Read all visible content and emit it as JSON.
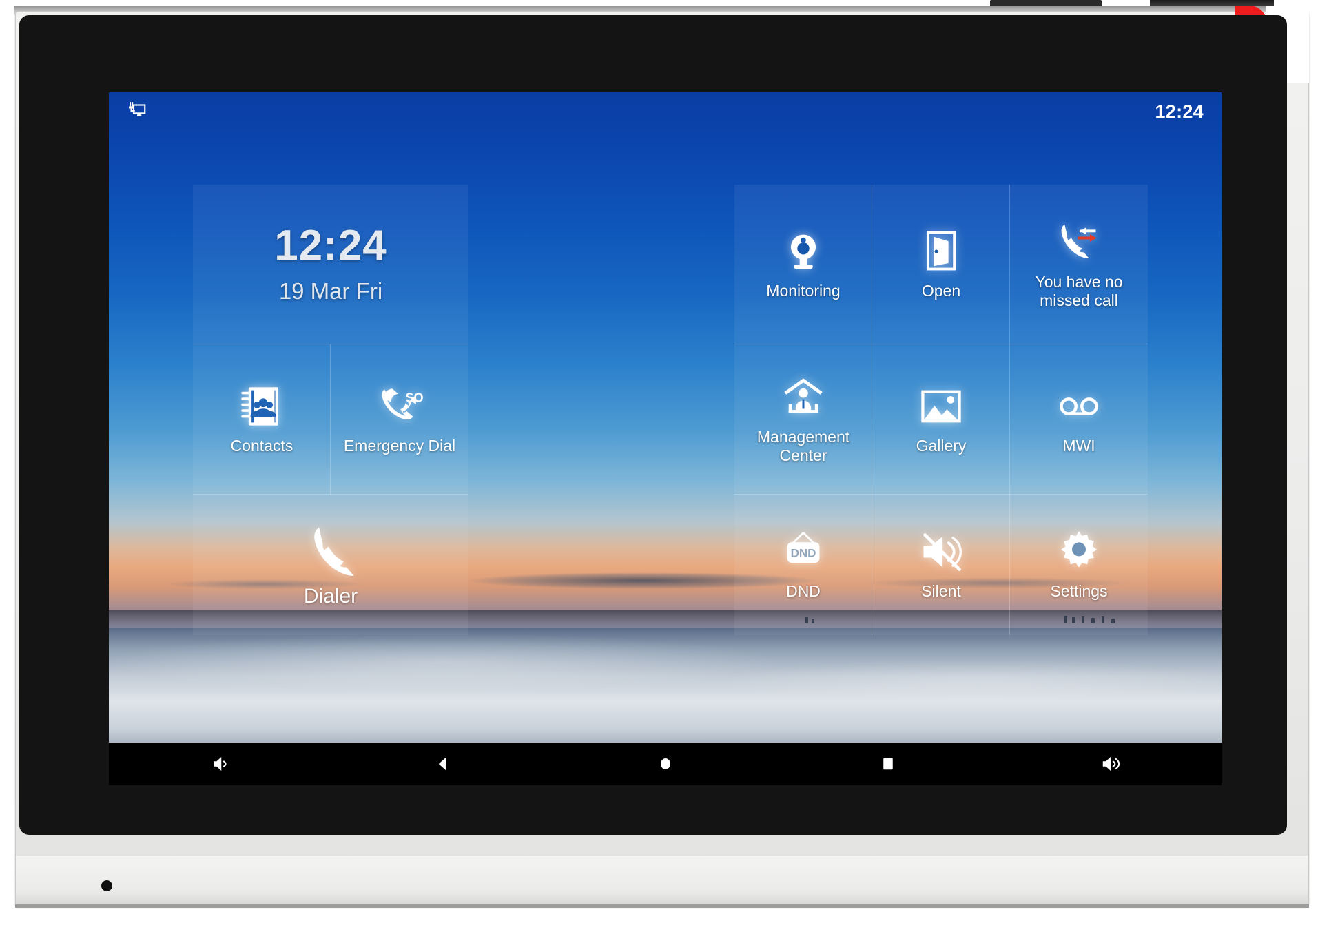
{
  "device": {
    "name": "SIP indoor monitor",
    "accent_color": "#ee1c1c",
    "body_color": "#ececeb",
    "glass_color": "#141414"
  },
  "status_bar": {
    "network_icon": "network-monitor-icon",
    "time": "12:24"
  },
  "clock_widget": {
    "time": "12:24",
    "date": "19 Mar Fri"
  },
  "left_panel": {
    "tiles": [
      {
        "label": "Contacts",
        "icon": "address-book-icon"
      },
      {
        "label": "Emergency Dial",
        "icon": "sos-phone-icon"
      },
      {
        "label": "Dialer",
        "icon": "phone-handset-icon"
      }
    ]
  },
  "right_panel": {
    "tiles": [
      {
        "label": "Monitoring",
        "icon": "camera-icon"
      },
      {
        "label": "Open",
        "icon": "open-door-icon"
      },
      {
        "label": "You have no missed call",
        "icon": "missed-call-icon"
      },
      {
        "label": "Management Center",
        "icon": "house-person-icon"
      },
      {
        "label": "Gallery",
        "icon": "picture-icon"
      },
      {
        "label": "MWI",
        "icon": "voicemail-icon"
      },
      {
        "label": "DND",
        "icon": "dnd-sign-icon"
      },
      {
        "label": "Silent",
        "icon": "speaker-mute-icon"
      },
      {
        "label": "Settings",
        "icon": "gear-icon"
      }
    ]
  },
  "nav_bar": {
    "buttons": [
      {
        "name": "volume-down-button",
        "icon": "speaker-low-icon"
      },
      {
        "name": "back-button",
        "icon": "triangle-left-icon"
      },
      {
        "name": "home-button",
        "icon": "circle-icon"
      },
      {
        "name": "recents-button",
        "icon": "square-icon"
      },
      {
        "name": "volume-up-button",
        "icon": "speaker-high-icon"
      }
    ]
  }
}
